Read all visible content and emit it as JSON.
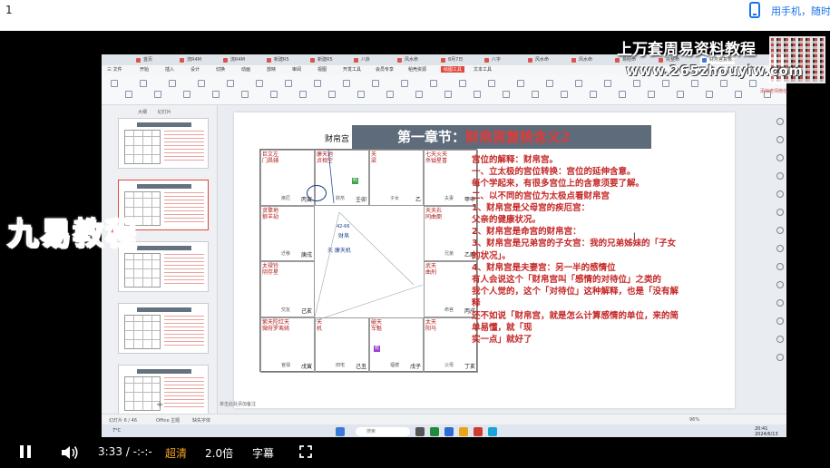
{
  "top": {
    "number": "1",
    "mobile_text": "用手机，随时"
  },
  "wps": {
    "tabs": [
      "首页",
      "流R4M",
      "流R4M",
      "新建R5",
      "新建R5",
      "八卦",
      "风水命",
      "8月7日",
      "八字",
      "风水命",
      "风水命",
      "易经命",
      "完整命",
      "财帛宫复核.."
    ],
    "menu": [
      "三 文件",
      "开始",
      "插入",
      "设计",
      "切换",
      "动画",
      "放映",
      "审阅",
      "视图",
      "开发工具",
      "会员专享",
      "稻壳资源",
      "绘图工具",
      "文本工具"
    ],
    "panel_tabs": [
      "大纲",
      "幻灯片"
    ],
    "slide_numbers": [
      "4",
      "5",
      "6",
      "7",
      "8",
      "9"
    ],
    "notes_placeholder": "单击此处添加备注",
    "status": [
      "幻灯片 6 / 46",
      "Office 主题",
      "缺失字体"
    ],
    "search_placeholder": "搜索",
    "zoom": "96%",
    "clock_time": "20:41",
    "clock_date": "2024/6/13",
    "weather": "7°C"
  },
  "slide": {
    "title_prefix": "第一章节：",
    "title_main": "财帛宫复核含义2",
    "chart_label": "财帛宫",
    "center_label": "天 廉天机",
    "ring_label": "财帛",
    "ring_number": "42-66",
    "cells": [
      {
        "stars": "巨文左\n门昌辅",
        "bottom": "疾厄",
        "box": "丙寅"
      },
      {
        "stars": "廉天地\n贞相空",
        "bottom": "财帛",
        "box": "壬卯"
      },
      {
        "stars": "天\n梁",
        "bottom": "子女",
        "box": "乙"
      },
      {
        "stars": "七天火天\n杀钺星喜",
        "bottom": "夫妻",
        "box": "甲申"
      },
      {
        "stars": "贪擎地\n狼羊劫",
        "bottom": "迁移",
        "box": "庚戌"
      },
      {
        "stars": "天天右\n同曲弼",
        "bottom": "兄弟",
        "box": "乙酉"
      },
      {
        "stars": "太禄铃\n阴存星",
        "bottom": "交友",
        "box": "己亥"
      },
      {
        "stars": "武天\n曲刑",
        "bottom": "命宫",
        "box": "丙戌"
      },
      {
        "stars": "紫天陀红天\n微府罗鸾姚",
        "bottom": "官禄",
        "box": "戊寅"
      },
      {
        "stars": "天\n机",
        "bottom": "田宅",
        "box": "己丑"
      },
      {
        "stars": "破天\n军魁",
        "bottom": "福德",
        "box": "戊子"
      },
      {
        "stars": "太天\n阳马",
        "bottom": "父母",
        "box": "丁亥"
      }
    ],
    "lines": [
      "宫位的解释：财帛宫。",
      "一、立太极的宫位转换：宫位的延伸含意。",
      "每个学起来，有很多宫位上的含意须要了解。",
      "",
      "二、以不同的宫位为太极点看财帛宫",
      "1、财帛宫是父母宫的疾厄宫：",
      "父亲的健康状况。",
      "2、财帛宫是命宫的财帛宫：",
      "3、财帛宫是兄弟宫的子女宫：我的兄弟姊妹的「子女的状况」。",
      "4、财帛宫是夫妻宫：另一半的感情位",
      "有人会说这个「财帛宫叫「感情的对待位」之类的",
      "我个人觉的，这个「对待位」这种解释，也是「没有解释",
      "还不如说「财帛宫，就是怎么计算感情的单位，来的简单易懂，就「现实一点」就好了"
    ],
    "text_lines": [
      "宫位的解释：财帛宫。",
      "一、立太极的宫位转换：宫位的延伸含意。",
      "每个学起来，有很多宫位上的含意须要了解。",
      "二、以不同的宫位为太极点看财帛宫",
      "1、财帛宫是父母宫的疾厄宫：",
      "父亲的健康状况。",
      "2、财帛宫是命宫的财帛宫：",
      "3、财帛宫是兄弟宫的子女宫：我的兄弟姊妹的「子女",
      "的状况」。",
      "4、财帛宫是夫妻宫：另一半的感情位",
      "有人会说这个「财帛宫叫「感情的对待位」之类的",
      "我个人觉的，这个「对待位」这种解释，也是「没有解",
      "释",
      "还不如说「财帛宫，就是怎么计算感情的单位，来的简",
      "单易懂，就「现",
      "实一点」就好了"
    ]
  },
  "overlay": {
    "watermark_title": "上万套周易资料教程",
    "watermark_url": "www.265zhouyiw.com",
    "watermark_small": "添加老师微信",
    "banner": "九易教程"
  },
  "player": {
    "time": "3:33 / -:-:-",
    "quality": "超清",
    "speed": "2.0倍",
    "subtitle": "字幕"
  }
}
